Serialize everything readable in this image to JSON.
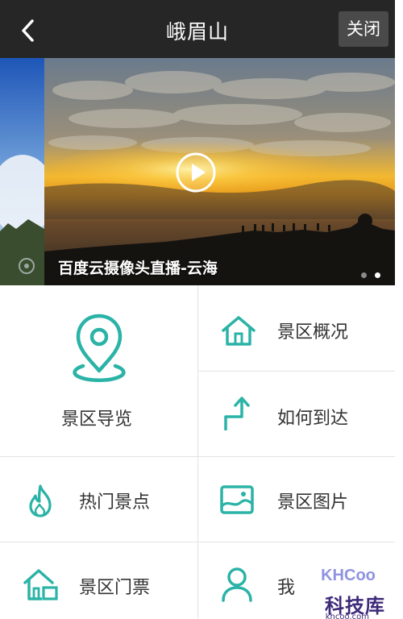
{
  "header": {
    "title": "峨眉山",
    "close_label": "关闭"
  },
  "banner": {
    "caption": "百度云摄像头直播-云海",
    "active_dot": 2,
    "dot_count": 2
  },
  "menu": {
    "guide": "景区导览",
    "overview": "景区概况",
    "directions": "如何到达",
    "hot_spots": "热门景点",
    "photos": "景区图片",
    "tickets": "景区门票",
    "mine": "我"
  },
  "colors": {
    "accent": "#2ab3a6",
    "header_bg": "#262626",
    "close_bg": "#4a4a4a",
    "text": "#333333",
    "divider": "#e3e3e3"
  },
  "icons": {
    "back": "chevron-left-icon",
    "play": "play-icon",
    "guide": "map-pin-icon",
    "overview": "house-icon",
    "directions": "route-arrow-icon",
    "hot_spots": "flame-icon",
    "photos": "image-icon",
    "tickets": "house-ticket-icon",
    "mine": "user-icon"
  },
  "watermark": {
    "logo_text": "KHCoo",
    "brand": "科技库",
    "url": "khcoo.com"
  }
}
